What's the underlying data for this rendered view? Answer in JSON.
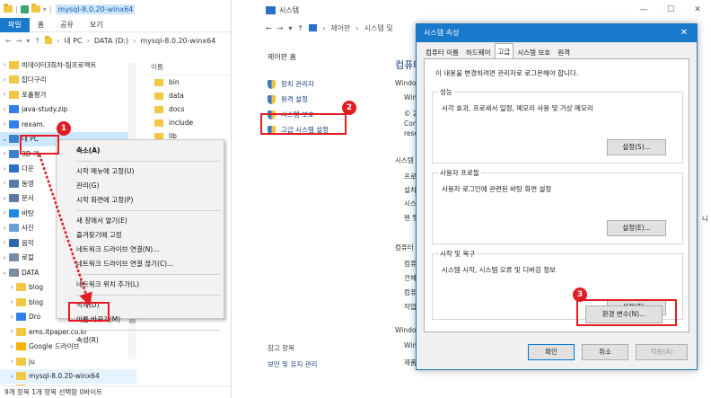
{
  "explorer": {
    "window_title": "mysql-8.0.20-winx64",
    "ribbon_tabs": [
      "파일",
      "홈",
      "공유",
      "보기"
    ],
    "address": [
      "내 PC",
      "DATA (D:)",
      "mysql-8.0.20-winx64"
    ],
    "tree": [
      {
        "label": "빅데이터3회차-팀프로젝트",
        "icon": "fold"
      },
      {
        "label": "잡다구리",
        "icon": "fold"
      },
      {
        "label": "포폴평가",
        "icon": "fold"
      },
      {
        "label": "java-study.zip",
        "icon": "zip"
      },
      {
        "label": "rexam.",
        "icon": "zip"
      },
      {
        "label": "내 PC",
        "icon": "pc"
      },
      {
        "label": "3D 개",
        "icon": "pc"
      },
      {
        "label": "다운",
        "icon": "down"
      },
      {
        "label": "동영",
        "icon": "doc"
      },
      {
        "label": "문서",
        "icon": "doc"
      },
      {
        "label": "바탕",
        "icon": "desk"
      },
      {
        "label": "사진",
        "icon": "pic"
      },
      {
        "label": "음악",
        "icon": "music"
      },
      {
        "label": "로컬",
        "icon": "drive"
      },
      {
        "label": "DATA",
        "icon": "drive"
      },
      {
        "label": "blog",
        "icon": "fold"
      },
      {
        "label": "blog",
        "icon": "fold"
      },
      {
        "label": "Dro",
        "icon": "zip"
      },
      {
        "label": "ems.itpaper.co.kr",
        "icon": "fold"
      },
      {
        "label": "Google 드라이브",
        "icon": "gdrive"
      },
      {
        "label": "ju",
        "icon": "fold"
      },
      {
        "label": "mysql-8.0.20-winx64",
        "icon": "fold"
      },
      {
        "label": "workspace-eclipse",
        "icon": "fold"
      }
    ],
    "content_header": "이름",
    "content_items": [
      "bin",
      "data",
      "docs",
      "include",
      "lib"
    ],
    "status": "9개 항목    1개 항목 선택함 0바이트"
  },
  "context_menu": {
    "items": [
      {
        "label": "축소(A)",
        "bold": true
      },
      {
        "sep": true
      },
      {
        "label": "시작 메뉴에 고정(U)"
      },
      {
        "label": "관리(G)"
      },
      {
        "label": "시작 화면에 고정(P)"
      },
      {
        "sep": true
      },
      {
        "label": "새 창에서 열기(E)"
      },
      {
        "label": "즐겨찾기에 고정"
      },
      {
        "label": "네트워크 드라이브 연결(N)..."
      },
      {
        "label": "네트워크 드라이브 연결 끊기(C)..."
      },
      {
        "sep": true
      },
      {
        "label": "네트워크 위치 추가(L)"
      },
      {
        "sep": true
      },
      {
        "label": "삭제(D)"
      },
      {
        "label": "이름 바꾸기(M)"
      },
      {
        "sep": true
      },
      {
        "label": "속성(R)"
      }
    ]
  },
  "system": {
    "window_title": "시스템",
    "address": [
      "제어판",
      "시스템 및"
    ],
    "home": "제어판 홈",
    "links": [
      "장치 관리자",
      "원격 설정",
      "시스템 보호",
      "고급 시스템 설정"
    ],
    "see_also_title": "참고 항목",
    "see_also_link": "보안 및 유지 관리",
    "bg_heading": "컴퓨터",
    "bg_labels": [
      "Windo",
      "Win",
      "© 2",
      "Cor",
      "rese",
      "시스템",
      "프로",
      "설치",
      "시스",
      "펜 및",
      "컴퓨터",
      "컴퓨",
      "전체",
      "컴퓨",
      "작업",
      "Window",
      "Win",
      "제품"
    ],
    "bg_right_char": "니"
  },
  "dialog": {
    "title": "시스템 속성",
    "tabs": [
      "컴퓨터 이름",
      "하드웨어",
      "고급",
      "시스템 보호",
      "원격"
    ],
    "active_tab": "고급",
    "note": "이 내용을 변경하려면 관리자로 로그온해야 합니다.",
    "groups": [
      {
        "title": "성능",
        "desc": "시각 효과, 프로세서 일정, 메모리 사용 및 가상 메모리",
        "button": "설정(S)..."
      },
      {
        "title": "사용자 프로필",
        "desc": "사용자 로그인에 관련된 바탕 화면 설정",
        "button": "설정(E)..."
      },
      {
        "title": "시작 및 복구",
        "desc": "시스템 시작, 시스템 오류 및 디버깅 정보",
        "button": "설정(T)..."
      }
    ],
    "env_button": "환경 변수(N)...",
    "ok": "확인",
    "cancel": "취소",
    "apply": "적용(A)"
  },
  "annotations": [
    "1",
    "2",
    "3"
  ],
  "colors": {
    "accent": "#1979ca",
    "annotation": "#e31b23"
  }
}
